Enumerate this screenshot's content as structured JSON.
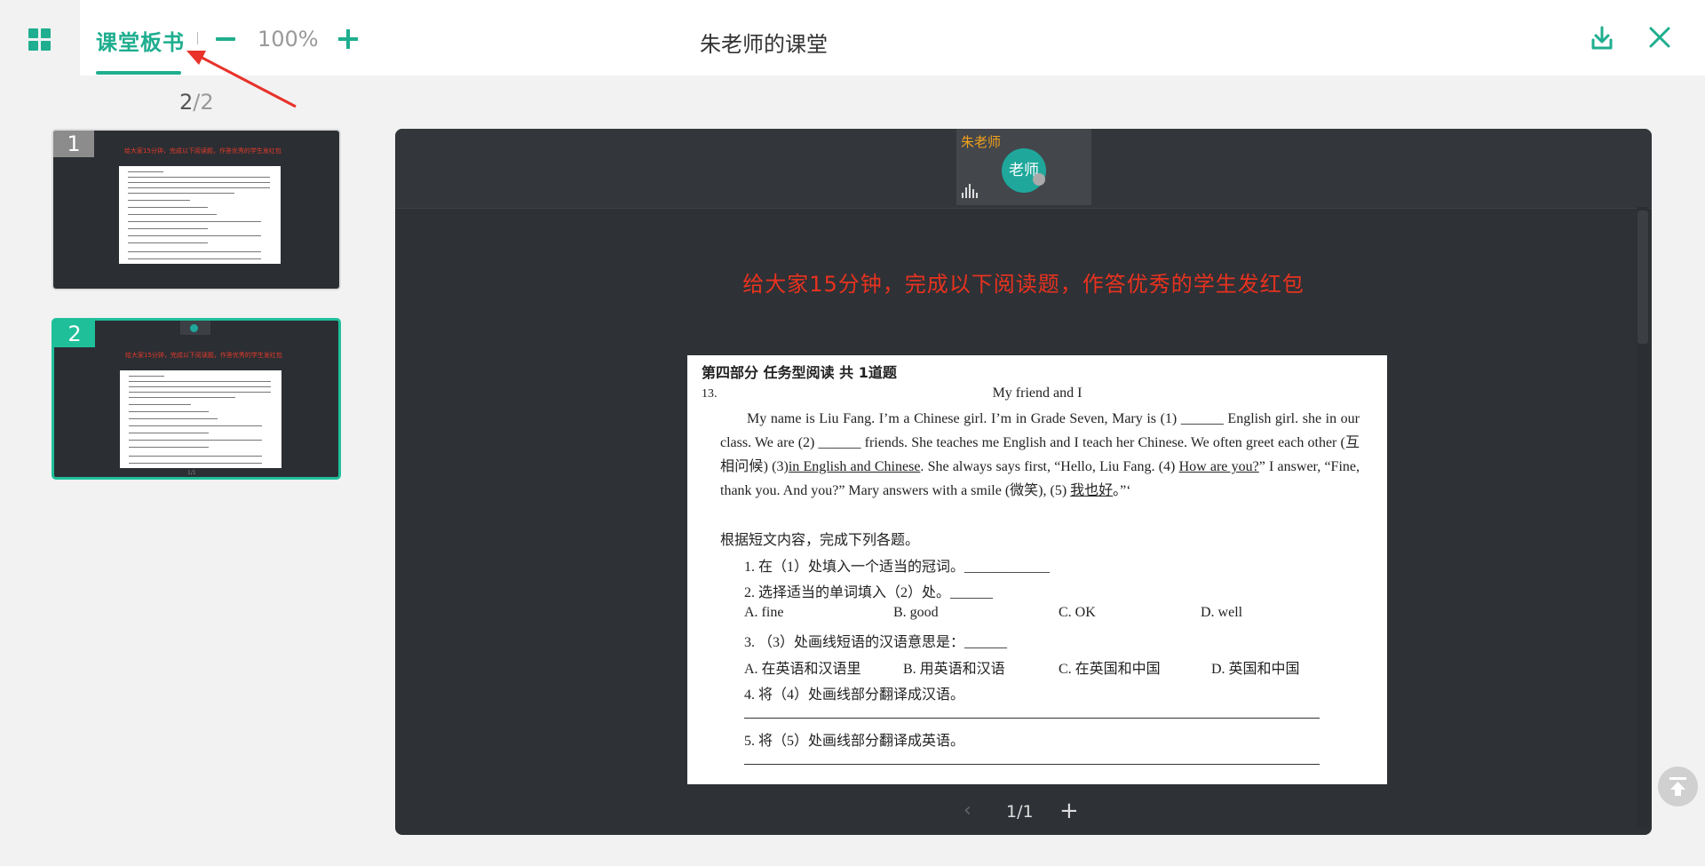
{
  "toolbar": {
    "tab_label": "课堂板书",
    "zoom_level": "100%",
    "window_title": "朱老师的课堂"
  },
  "pages": {
    "current": "2",
    "separator": "/",
    "total": "2"
  },
  "thumbnails": [
    {
      "number": "1",
      "caption": "给大家15分钟，完成以下阅读题，作答优秀的学生发红包"
    },
    {
      "number": "2",
      "caption": "给大家15分钟，完成以下阅读题，作答优秀的学生发红包"
    }
  ],
  "camera": {
    "name": "朱老师",
    "avatar_text": "老师"
  },
  "board": {
    "caption": "给大家15分钟，完成以下阅读题，作答优秀的学生发红包"
  },
  "document": {
    "section": "第四部分  任务型阅读  共 1道题",
    "question_no": "13.",
    "title": "My friend and I",
    "p_a": "My name is Liu Fang. I’m a Chinese girl. I’m in Grade Seven, Mary is (1) ______ English girl. she in our class. We are (2) ______ friends. She teaches me English and I teach her Chinese. We often greet each other (互相问候) (3)",
    "p_u1": "in English and Chinese",
    "p_b": ". She always says first, “Hello, Liu Fang. (4) ",
    "p_u2": "How are you?",
    "p_c": "” I answer, “Fine, thank you. And you?” Mary answers with a smile (微笑), (5) ",
    "p_u3": "我也好",
    "p_d": "。”‘",
    "instruction": "根据短文内容，完成下列各题。",
    "q1": "1.  在（1）处填入一个适当的冠词。____________",
    "q2": "2.  选择适当的单词填入（2）处。______",
    "q2_options": [
      "A.    fine",
      "B.    good",
      "C.    OK",
      "D.    well"
    ],
    "q3": "3.  （3）处画线短语的汉语意思是：______",
    "q3_options": [
      "A.    在英语和汉语里",
      "B.    用英语和汉语",
      "C.    在英国和中国",
      "D.    英国和中国"
    ],
    "q4": "4.  将（4）处画线部分翻译成汉语。",
    "q5": "5.  将（5）处画线部分翻译成英语。"
  },
  "pager": {
    "prev": "‹",
    "page": "1/1",
    "add": "+"
  },
  "colors": {
    "accent": "#1fae8f",
    "caption_red": "#e8321f",
    "annotation_red": "#e8322a",
    "camera_name": "#f0a11c"
  },
  "icons": [
    "grid-icon",
    "minus-icon",
    "plus-icon",
    "download-icon",
    "close-icon",
    "audio-icon",
    "back-to-top-icon"
  ]
}
